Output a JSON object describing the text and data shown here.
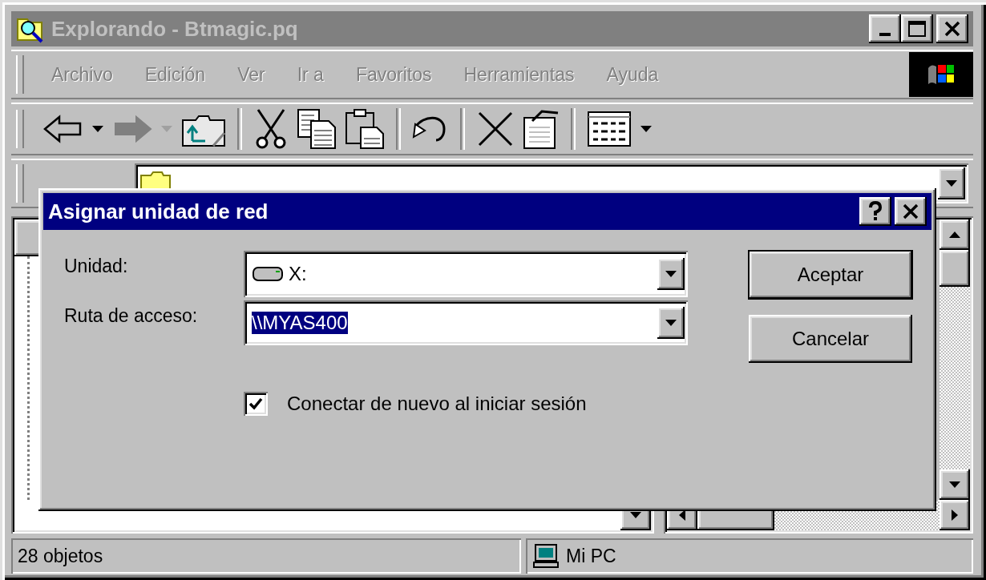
{
  "window": {
    "title": "Explorando - Btmagic.pq",
    "active": false
  },
  "menu": [
    {
      "label": "Archivo",
      "disabled": true
    },
    {
      "label": "Edición",
      "disabled": true
    },
    {
      "label": "Ver",
      "disabled": true
    },
    {
      "label": "Ir a",
      "disabled": true
    },
    {
      "label": "Favoritos",
      "disabled": true
    },
    {
      "label": "Herramientas",
      "disabled": true
    },
    {
      "label": "Ayuda",
      "disabled": true
    }
  ],
  "toolbar": [
    {
      "kind": "back",
      "disabled": false
    },
    {
      "kind": "dropdown",
      "disabled": false
    },
    {
      "kind": "forward",
      "disabled": true
    },
    {
      "kind": "dropdown",
      "disabled": true
    },
    {
      "kind": "up",
      "disabled": false
    },
    {
      "kind": "separator",
      "disabled": false
    },
    {
      "kind": "cut",
      "disabled": false
    },
    {
      "kind": "copy",
      "disabled": false
    },
    {
      "kind": "paste",
      "disabled": false
    },
    {
      "kind": "separator",
      "disabled": false
    },
    {
      "kind": "undo",
      "disabled": false
    },
    {
      "kind": "separator",
      "disabled": false
    },
    {
      "kind": "delete",
      "disabled": false
    },
    {
      "kind": "properties",
      "disabled": false
    },
    {
      "kind": "separator",
      "disabled": false
    },
    {
      "kind": "views",
      "disabled": false
    },
    {
      "kind": "dropdown",
      "disabled": false
    }
  ],
  "dialog": {
    "title": "Asignar unidad de red",
    "fields": [
      {
        "kind": "drive",
        "label": "Unidad:",
        "value": "X:",
        "value_selected": false
      },
      {
        "kind": "path",
        "label": "Ruta de acceso:",
        "value": "\\\\MYAS400",
        "value_selected": true
      }
    ],
    "checkbox": {
      "label": "Conectar de nuevo al iniciar sesión",
      "checked": true
    },
    "buttons": [
      {
        "label": "Aceptar",
        "default": true
      },
      {
        "label": "Cancelar",
        "default": false
      }
    ]
  },
  "status_bar": [
    {
      "kind": "text",
      "text": "28 objetos"
    },
    {
      "kind": "computer",
      "text": "Mi PC"
    }
  ]
}
